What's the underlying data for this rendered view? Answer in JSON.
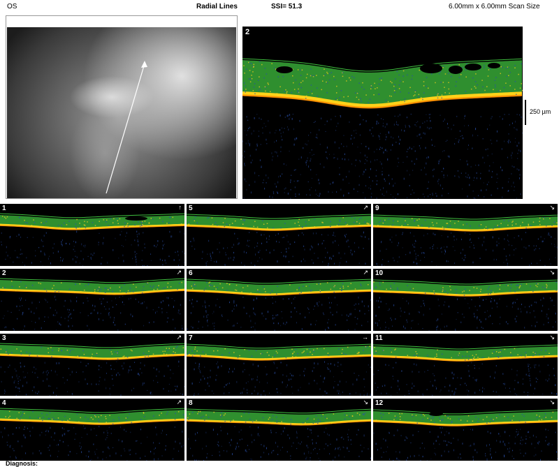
{
  "header": {
    "eye": "OS",
    "scan_type": "Radial Lines",
    "ssi": "SSI= 51.3",
    "scan_size": "6.00mm x 6.00mm Scan Size"
  },
  "main_scan": {
    "number": "2",
    "scale_label": "250 µm"
  },
  "thumbnails": [
    {
      "number": "1",
      "indicator": "↑"
    },
    {
      "number": "5",
      "indicator": "↗"
    },
    {
      "number": "9",
      "indicator": "↘"
    },
    {
      "number": "2",
      "indicator": "↗"
    },
    {
      "number": "6",
      "indicator": "↗"
    },
    {
      "number": "10",
      "indicator": "↘"
    },
    {
      "number": "3",
      "indicator": "↗"
    },
    {
      "number": "7",
      "indicator": "→"
    },
    {
      "number": "11",
      "indicator": "↘"
    },
    {
      "number": "4",
      "indicator": "↗"
    },
    {
      "number": "8",
      "indicator": "↘"
    },
    {
      "number": "12",
      "indicator": "↘"
    }
  ],
  "footer": {
    "diagnosis_label": "Diagnosis:"
  },
  "colors": {
    "retina_green": "#3fbf3f",
    "rpe_yellow": "#ffd21a",
    "rpe_orange": "#ff8a00",
    "speckle_blue": "#2a4fa8",
    "background": "#000000"
  }
}
